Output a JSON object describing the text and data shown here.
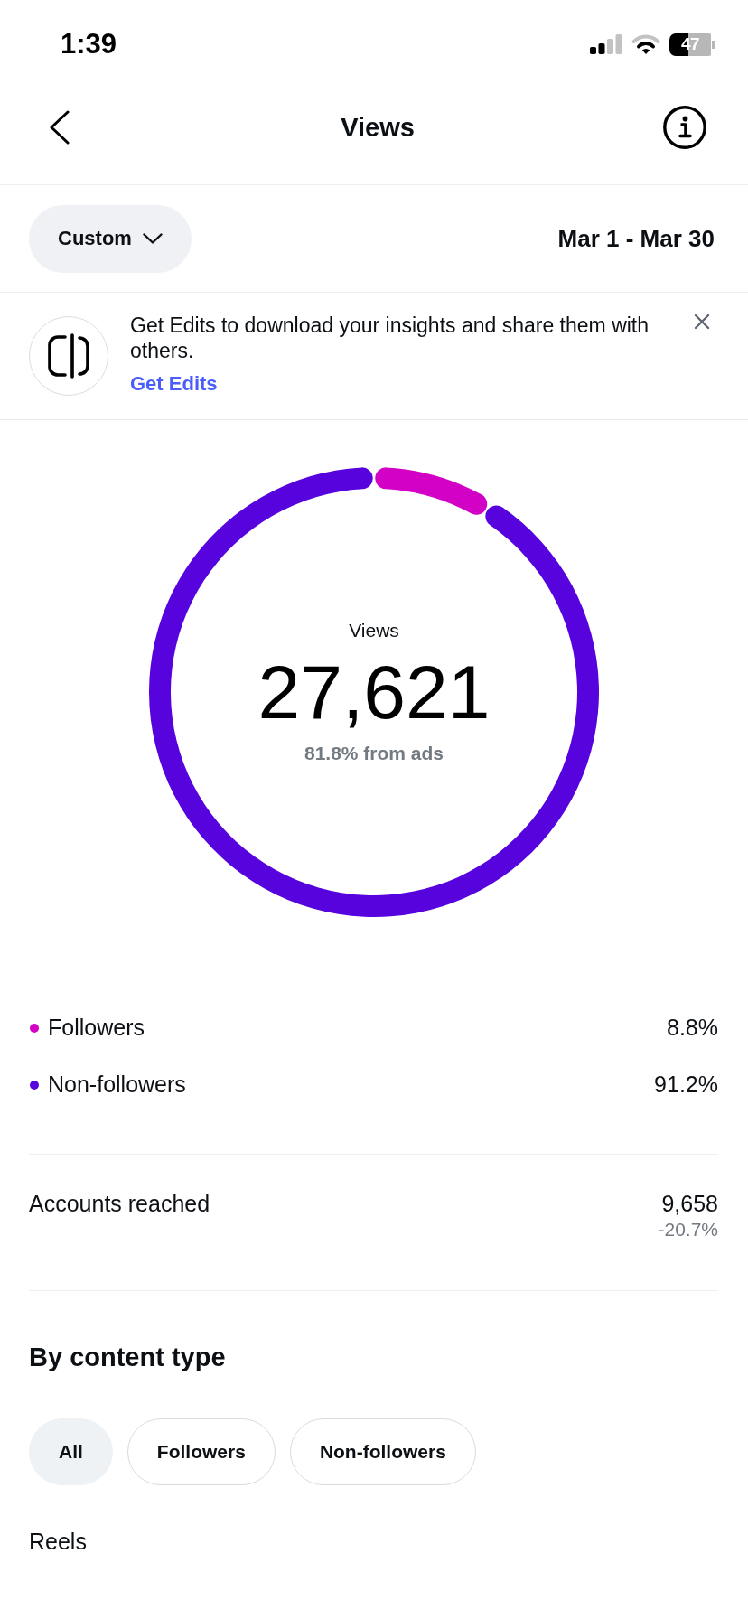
{
  "status_bar": {
    "time": "1:39",
    "battery": "47"
  },
  "header": {
    "title": "Views"
  },
  "date_filter": {
    "range": "Custom",
    "dates": "Mar 1 - Mar 30"
  },
  "banner": {
    "message": "Get Edits to download your insights and share them with others.",
    "link": "Get Edits"
  },
  "overview": {
    "label": "Views",
    "total": "27,621",
    "note": "81.8% from ads",
    "chart_data": {
      "type": "donut",
      "categories": [
        "Followers",
        "Non-followers"
      ],
      "values": [
        8.8,
        91.2
      ]
    }
  },
  "legend": [
    {
      "value": "8.8%",
      "color": "#d300c5"
    },
    {
      "value": "91.2%",
      "color": "#5603de"
    }
  ],
  "metrics": [
    {
      "label": "Accounts reached",
      "value": "9,658",
      "change": "-20.7%"
    }
  ],
  "content_type": {
    "title": "By content type",
    "filters": [
      {
        "label": "All",
        "selected": true
      },
      {
        "label": "Followers",
        "selected": false
      },
      {
        "label": "Non-followers",
        "selected": false
      }
    ],
    "sections": [
      {
        "title": "Reels"
      }
    ]
  }
}
